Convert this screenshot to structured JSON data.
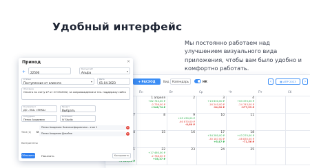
{
  "headline": "Удобный интерфейс",
  "description": "Мы постоянно работаем над улучшением визуального вида приложения, чтобы вам было удобно и комфортно работать.",
  "colors": {
    "accent": "#3b8df5",
    "income": "#2db04b",
    "expense": "#e2453c"
  },
  "toolbar": {
    "expense_button": "+ РАСХОД",
    "view_label": "Вид",
    "view_value": "Календарь",
    "toggle_label": "НК",
    "prev_icon": "chevron-left-icon",
    "next_icon": "chevron-right-icon",
    "date_button": "▦ АПР 2023"
  },
  "calendar": {
    "weekdays": [
      "",
      "Пн",
      "Вт",
      "Ср",
      "Чт",
      "Пт",
      "Сб"
    ],
    "rows": [
      [
        {
          "d": "",
          "lines": []
        },
        {
          "d": "1 апреля",
          "lines": [
            {
              "t": "+82 740,00 ₽",
              "c": "g"
            },
            {
              "t": "-0 736,00 ₽",
              "c": "r"
            },
            {
              "t": "+346,74 ₽",
              "c": "b"
            }
          ]
        },
        {
          "d": "2",
          "lines": []
        },
        {
          "d": "3",
          "lines": [
            {
              "t": "+13 630,00 ₽",
              "c": "g"
            },
            {
              "t": "-16 240,00 ₽",
              "c": "r"
            },
            {
              "t": "-24,00 ₽",
              "c": "br"
            }
          ]
        },
        {
          "d": "4",
          "lines": [
            {
              "t": "+63 370,00 ₽",
              "c": "g"
            },
            {
              "t": "-24 743,00 ₽",
              "c": "r"
            },
            {
              "t": "-977,53 ₽",
              "c": "br"
            }
          ]
        },
        {
          "d": "",
          "lines": []
        },
        {
          "d": "",
          "lines": []
        }
      ],
      [
        {
          "d": "7",
          "lines": []
        },
        {
          "d": "8",
          "lines": []
        },
        {
          "d": "9",
          "lines": [
            {
              "t": "+63 430,00 ₽",
              "c": "g"
            },
            {
              "t": "-60 870,00 ₽",
              "c": "r"
            },
            {
              "t": "-8,60 ₽",
              "c": "br"
            }
          ]
        },
        {
          "d": "10",
          "lines": []
        },
        {
          "d": "11",
          "lines": []
        },
        {
          "d": "",
          "lines": []
        },
        {
          "d": "",
          "lines": []
        }
      ],
      [
        {
          "d": "14",
          "lines": []
        },
        {
          "d": "15",
          "lines": []
        },
        {
          "d": "16",
          "lines": []
        },
        {
          "d": "17",
          "lines": [
            {
              "t": "+34 280,00 ₽",
              "c": "g"
            },
            {
              "t": "-30 187,00 ₽",
              "c": "r"
            },
            {
              "t": "+5,47 ₽",
              "c": "b"
            }
          ]
        },
        {
          "d": "18",
          "lines": [
            {
              "t": "+43 270,00 ₽",
              "c": "g"
            },
            {
              "t": "-48 830,00 ₽",
              "c": "r"
            },
            {
              "t": "-71,56 ₽",
              "c": "br"
            }
          ]
        },
        {
          "d": "",
          "lines": []
        },
        {
          "d": "",
          "lines": []
        }
      ],
      [
        {
          "d": "21",
          "lines": []
        },
        {
          "d": "22",
          "lines": [
            {
              "t": "+17 460,00 ₽",
              "c": "g"
            },
            {
              "t": "-2 788,00 ₽",
              "c": "r"
            },
            {
              "t": "+35,37 ₽",
              "c": "b"
            }
          ]
        },
        {
          "d": "23",
          "lines": []
        },
        {
          "d": "24",
          "lines": []
        },
        {
          "d": "25",
          "lines": []
        },
        {
          "d": "",
          "lines": []
        },
        {
          "d": "",
          "lines": []
        }
      ]
    ],
    "corner_line": "+1 533,00 ₽"
  },
  "modal": {
    "title": "Приход",
    "close_icon": "close-icon",
    "amount_value": "22500",
    "account_label": "Кассы/счёт",
    "account_value": "Альфа",
    "article_label": "Статья",
    "article_value": "Поступление от клиента",
    "date_label": "Дата",
    "date_value": "01.04.2023",
    "comment_label": "Описание",
    "comment_value": "Оплата по счету 27 от 27.03.2022, за сопровождение и тех. поддержку сайта",
    "contract_label": "Контрагент",
    "contract_value": "ДО - ЕКА. «ЯНКА»",
    "project_label": "Проект",
    "project_value": "Выбрать",
    "employee_label": "Сотрудник",
    "employee_value": "Пенко Академия",
    "company_label": "Компания",
    "company_value": "IV Studio",
    "tags_label": "Теги (1)",
    "tags": [
      "Пенко Академия: Бизнесинформатика - этап 1",
      "Пенко Академия Дизайна"
    ],
    "contractors_label": "Контрагенты",
    "save_label": "Обновить",
    "cancel_label": "Показать",
    "copy_label": "Копировать"
  }
}
